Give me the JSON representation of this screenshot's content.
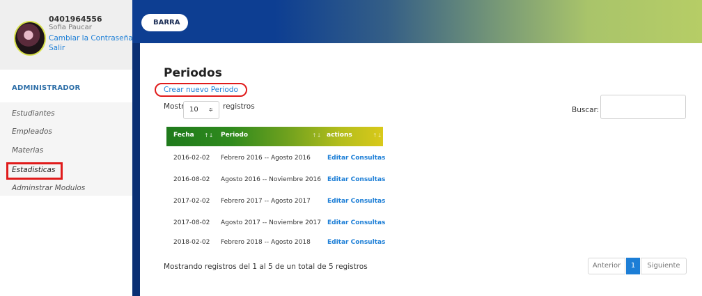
{
  "user": {
    "id": "0401964556",
    "name": "Sofia Paucar",
    "change_password": "Cambiar la Contraseña",
    "logout": "Salir"
  },
  "sidebar": {
    "role_title": "ADMINISTRADOR",
    "items": [
      {
        "label": "Estudiantes"
      },
      {
        "label": "Empleados"
      },
      {
        "label": "Materias"
      },
      {
        "label": "Estadisticas"
      },
      {
        "label": "Adminstrar Modulos"
      }
    ]
  },
  "topbar": {
    "button_label": "BARRA"
  },
  "main": {
    "title": "Periodos",
    "create_link": "Crear nuevo Periodo",
    "show_label": "Mostrar",
    "show_value": "10",
    "show_arrow": "≑",
    "records_label": "registros",
    "search_label": "Buscar:",
    "search_value": "",
    "info": "Mostrando registros del 1 al 5 de un total de 5 registros"
  },
  "table": {
    "headers": [
      "Fecha",
      "Periodo",
      "actions"
    ],
    "sort_icon": "↑↓",
    "rows": [
      {
        "fecha": "2016-02-02",
        "periodo": "Febrero 2016 -- Agosto 2016",
        "action": "Editar Consultas"
      },
      {
        "fecha": "2016-08-02",
        "periodo": "Agosto 2016 -- Noviembre 2016",
        "action": "Editar Consultas"
      },
      {
        "fecha": "2017-02-02",
        "periodo": "Febrero 2017 -- Agosto 2017",
        "action": "Editar Consultas"
      },
      {
        "fecha": "2017-08-02",
        "periodo": "Agosto 2017 -- Noviembre 2017",
        "action": "Editar Consultas"
      },
      {
        "fecha": "2018-02-02",
        "periodo": "Febrero 2018 -- Agosto 2018",
        "action": "Editar Consultas"
      }
    ]
  },
  "pagination": {
    "prev": "Anterior",
    "current": "1",
    "next": "Siguiente"
  },
  "colors": {
    "accent": "#1c7ed6",
    "highlight": "#e01b1b",
    "divider": "#0a2f73"
  }
}
